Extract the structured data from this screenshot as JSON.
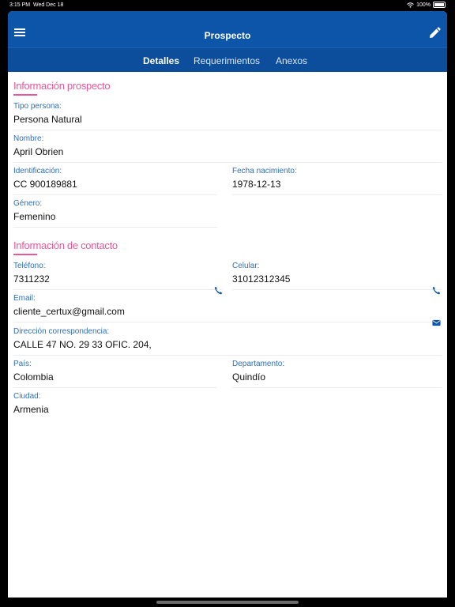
{
  "status": {
    "time": "3:15 PM",
    "date": "Wed Dec 18",
    "battery": "100%"
  },
  "header": {
    "title": "Prospecto"
  },
  "tabs": [
    {
      "label": "Detalles"
    },
    {
      "label": "Requerimientos"
    },
    {
      "label": "Anexos"
    }
  ],
  "prospect_section": {
    "title": "Información prospecto",
    "tipo_persona": {
      "label": "Tipo persona:",
      "value": "Persona Natural"
    },
    "nombre": {
      "label": "Nombre:",
      "value": "April Obrien"
    },
    "identificacion": {
      "label": "Identificación:",
      "value": "CC 900189881"
    },
    "fecha_nacimiento": {
      "label": "Fecha nacimiento:",
      "value": "1978-12-13"
    },
    "genero": {
      "label": "Género:",
      "value": "Femenino"
    }
  },
  "contact_section": {
    "title": "Información de contacto",
    "telefono": {
      "label": "Teléfono:",
      "value": "7311232"
    },
    "celular": {
      "label": "Celular:",
      "value": "31012312345"
    },
    "email": {
      "label": "Email:",
      "value": "cliente_certux@gmail.com"
    },
    "direccion": {
      "label": "Dirección correspondencia:",
      "value": "CALLE 47 NO. 29 33 OFIC. 204,"
    },
    "pais": {
      "label": "País:",
      "value": "Colombia"
    },
    "departamento": {
      "label": "Departamento:",
      "value": "Quindío"
    },
    "ciudad": {
      "label": "Ciudad:",
      "value": "Armenia"
    }
  },
  "icons": {
    "menu": "menu-icon",
    "edit": "pencil-icon",
    "phone": "phone-icon",
    "email": "envelope-icon",
    "wifi": "wifi-icon",
    "battery": "battery-icon"
  },
  "colors": {
    "primary": "#0d55a8",
    "accent": "#e8579a",
    "label": "#2f6fb4"
  }
}
